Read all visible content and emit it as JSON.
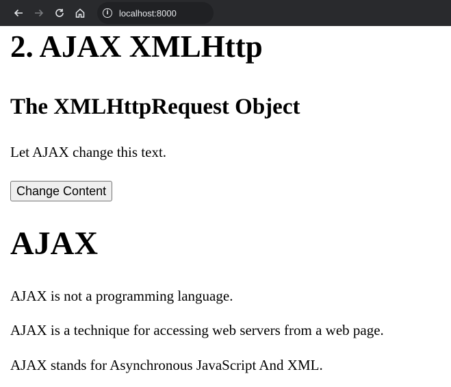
{
  "browser": {
    "url": "localhost:8000",
    "icons": [
      "back-arrow-icon",
      "forward-arrow-icon",
      "reload-icon",
      "home-icon",
      "info-icon"
    ]
  },
  "page": {
    "main_heading": "2. AJAX XMLHttp",
    "sub_heading": "The XMLHttpRequest Object",
    "demo_text": "Let AJAX change this text.",
    "button_label": "Change Content",
    "ajax_heading": "AJAX",
    "paragraphs": [
      "AJAX is not a programming language.",
      "AJAX is a technique for accessing web servers from a web page.",
      "AJAX stands for Asynchronous JavaScript And XML."
    ]
  },
  "colors": {
    "toolbar_bg": "#292a2d",
    "address_bg": "#202124",
    "toolbar_text": "#e8eaed",
    "page_bg": "#ffffff",
    "button_bg": "#efefef"
  }
}
